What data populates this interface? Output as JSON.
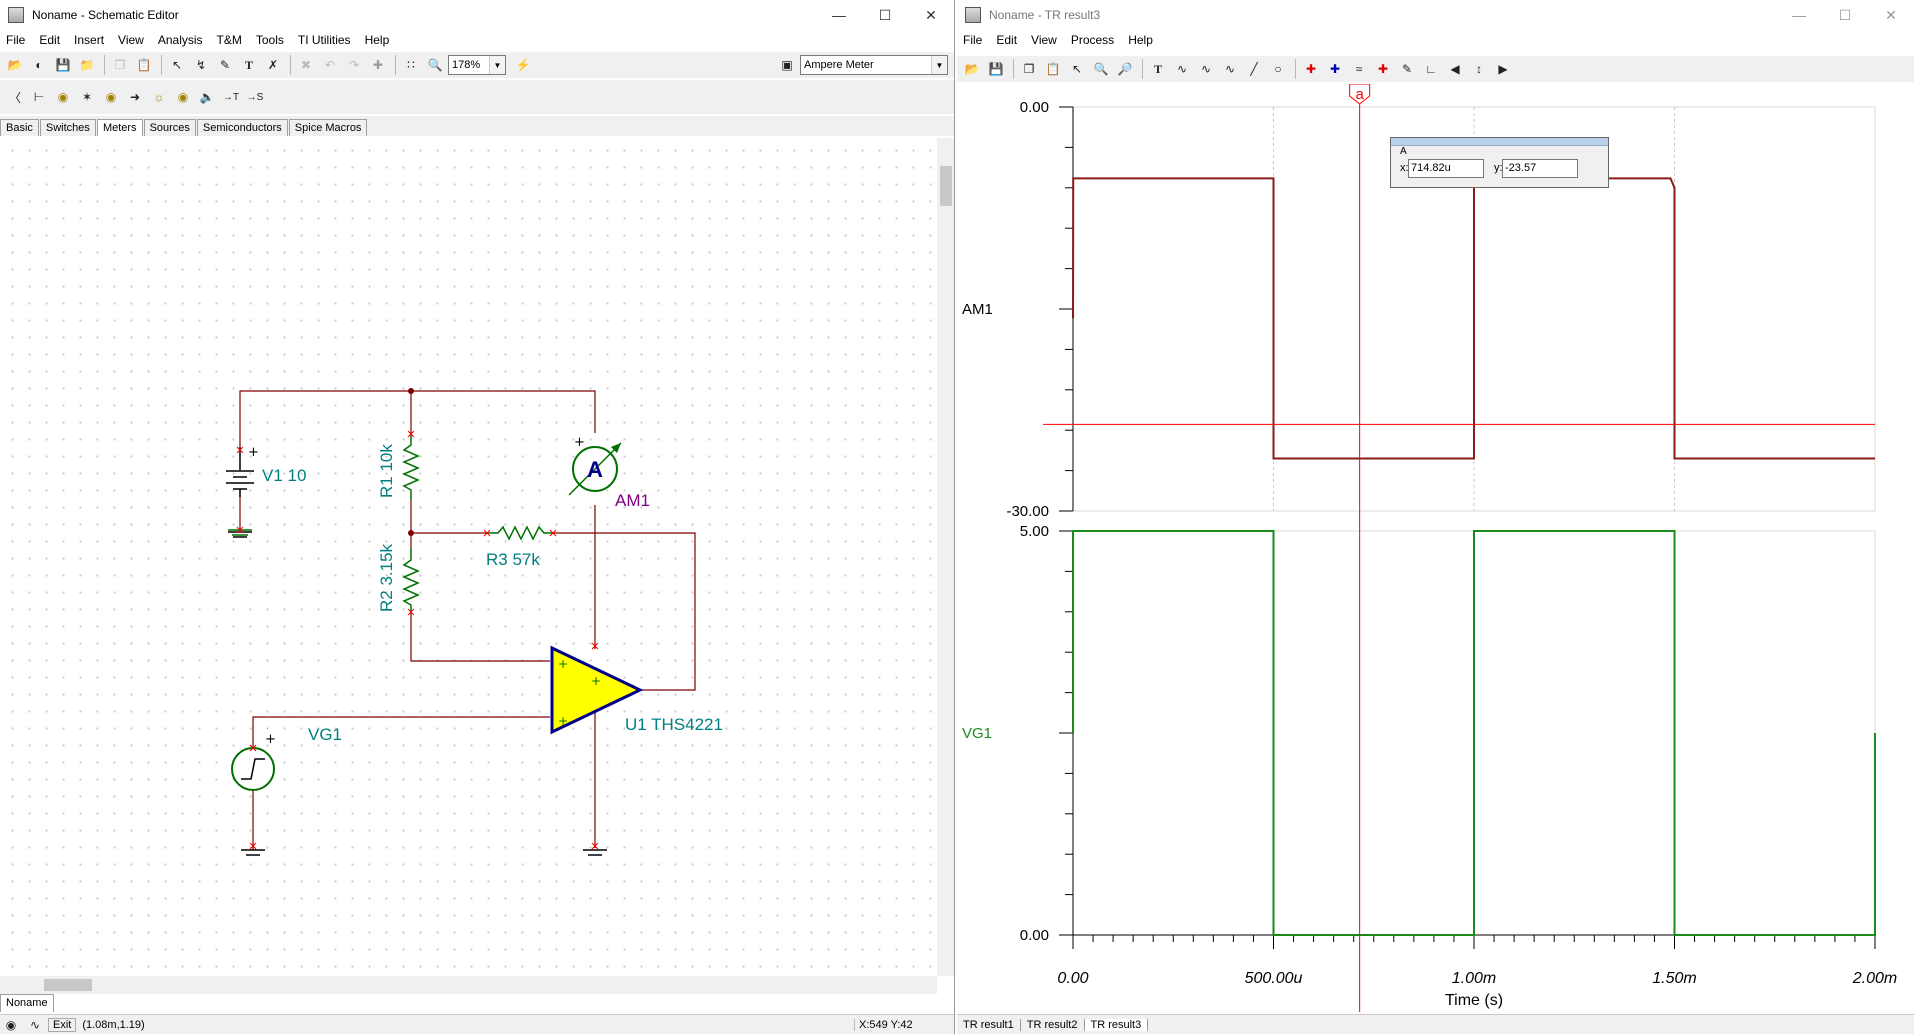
{
  "left_window": {
    "title": "Noname - Schematic Editor",
    "menu": [
      "File",
      "Edit",
      "Insert",
      "View",
      "Analysis",
      "T&M",
      "Tools",
      "TI Utilities",
      "Help"
    ],
    "zoom": "178%",
    "component_combo": "Ampere Meter",
    "palette_tabs": [
      "Basic",
      "Switches",
      "Meters",
      "Sources",
      "Semiconductors",
      "Spice Macros"
    ],
    "active_tab": "Meters",
    "document_tab": "Noname",
    "status_coords": "(1.08m,1.19)",
    "status_exit": "Exit",
    "status_xy": "X:549 Y:42",
    "schematic": {
      "v1": "V1 10",
      "r1": "R1 10k",
      "r2": "R2 3.15k",
      "r3": "R3 57k",
      "am1": "AM1",
      "am1_symbol": "A",
      "vg1": "VG1",
      "u1": "U1 THS4221",
      "plus": "+"
    }
  },
  "right_window": {
    "title": "Noname - TR result3",
    "menu": [
      "File",
      "Edit",
      "View",
      "Process",
      "Help"
    ],
    "cursor_box": {
      "label": "A",
      "x_label": "x:",
      "x_value": "714.82u",
      "y_label": "y:",
      "y_value": "-23.57"
    },
    "cursor_marker": "a",
    "result_tabs": [
      "TR result1",
      "TR result2",
      "TR result3"
    ]
  },
  "chart_data": [
    {
      "type": "line",
      "series": [
        {
          "name": "AM1",
          "x": [
            0,
            5e-07,
            5e-07,
            0.0005,
            0.0005,
            0.001,
            0.001,
            0.00149,
            0.0015,
            0.0015,
            0.002
          ],
          "values": [
            -15.7,
            -5.3,
            -5.3,
            -5.3,
            -26.1,
            -26.1,
            -5.3,
            -5.3,
            -6.0,
            -26.1,
            -26.1
          ]
        }
      ],
      "ylim": [
        -30,
        0
      ],
      "yticks": [
        "0.00",
        "-30.00"
      ],
      "xlim": [
        0,
        0.002
      ],
      "color": "#8b1a1a",
      "grid": true
    },
    {
      "type": "line",
      "series": [
        {
          "name": "VG1",
          "x": [
            0,
            0,
            0.0005,
            0.0005,
            0.001,
            0.001,
            0.0015,
            0.0015,
            0.002,
            0.002
          ],
          "values": [
            2.5,
            5,
            5,
            0,
            0,
            5,
            5,
            0,
            0,
            2.5
          ]
        }
      ],
      "ylim": [
        0,
        5
      ],
      "yticks": [
        "5.00",
        "0.00"
      ],
      "xlim": [
        0,
        0.002
      ],
      "xticks": [
        "0.00",
        "500.00u",
        "1.00m",
        "1.50m",
        "2.00m"
      ],
      "xlabel": "Time (s)",
      "color": "#1a8a1a",
      "grid": true
    }
  ],
  "colors": {
    "wire": "#800000",
    "resistor": "#007000",
    "label_teal": "#008080",
    "label_purple": "#800080",
    "opamp_fill": "#ffff00",
    "opamp_edge": "#00008b",
    "cursor_line": "#ff0000"
  }
}
